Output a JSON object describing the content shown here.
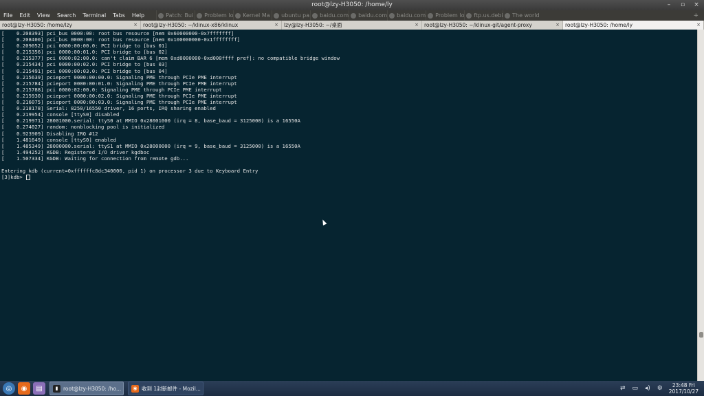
{
  "window": {
    "title": "root@lzy-H3050: /home/ly",
    "controls": [
      "–",
      "▫",
      "×"
    ]
  },
  "menubar": {
    "items": [
      "File",
      "Edit",
      "View",
      "Search",
      "Terminal",
      "Tabs",
      "Help"
    ],
    "background_tabs": [
      "Patch: Bui",
      "Problem lo",
      "Kernel Ma",
      "ubuntu pa",
      "baidu.com",
      "baidu.com",
      "baidu.com",
      "Problem lo",
      "ftp.us.debia",
      "The world"
    ],
    "right_add": "+"
  },
  "tabs": [
    {
      "label": "root@lzy-H3050: /home/lzy",
      "active": false
    },
    {
      "label": "root@lzy-H3050: ~/klinux-x86/klinux",
      "active": false
    },
    {
      "label": "lzy@lzy-H3050: ~/桌面",
      "active": false
    },
    {
      "label": "root@lzy-H3050: ~/klinux-git/agent-proxy",
      "active": false
    },
    {
      "label": "root@lzy-H3050: /home/ly",
      "active": true
    }
  ],
  "tab_close_glyph": "×",
  "terminal": {
    "lines": [
      "[    0.208393] pci_bus 0000:00: root bus resource [mem 0x60000000-0x7fffffff]",
      "[    0.208400] pci_bus 0000:00: root bus resource [mem 0x100000000-0x1ffffffff]",
      "[    0.209052] pci 0000:00:00.0: PCI bridge to [bus 01]",
      "[    0.215356] pci 0000:00:01.0: PCI bridge to [bus 02]",
      "[    0.215377] pci 0000:02:00.0: can't claim BAR 6 [mem 0xd0000000-0xd000ffff pref]: no compatible bridge window",
      "[    0.215434] pci 0000:00:02.0: PCI bridge to [bus 03]",
      "[    0.215491] pci 0000:00:03.0: PCI bridge to [bus 04]",
      "[    0.215639] pcieport 0000:00:00.0: Signaling PME through PCIe PME interrupt",
      "[    0.215784] pcieport 0000:00:01.0: Signaling PME through PCIe PME interrupt",
      "[    0.215788] pci 0000:02:00.0: Signaling PME through PCIe PME interrupt",
      "[    0.215930] pcieport 0000:00:02.0: Signaling PME through PCIe PME interrupt",
      "[    0.216075] pcieport 0000:00:03.0: Signaling PME through PCIe PME interrupt",
      "[    0.218178] Serial: 8250/16550 driver, 16 ports, IRQ sharing enabled",
      "[    0.219954] console [ttyS0] disabled",
      "[    0.219971] 28001000.serial: ttyS0 at MMIO 0x28001000 (irq = 8, base_baud = 3125000) is a 16550A",
      "[    0.274027] random: nonblocking pool is initialized",
      "[    0.923909] Disabling IRQ #12",
      "[    1.481649] console [ttyS0] enabled",
      "[    1.485349] 28000000.serial: ttyS1 at MMIO 0x28000000 (irq = 9, base_baud = 3125000) is a 16550A",
      "[    1.494252] KGDB: Registered I/O driver kgdboc",
      "[    1.507334] KGDB: Waiting for connection from remote gdb...",
      "",
      "Entering kdb (current=0xffffffc8dc340000, pid 1) on processor 3 due to Keyboard Entry"
    ],
    "prompt": "[3]kdb> "
  },
  "taskbar": {
    "launchers": [
      {
        "name": "start",
        "glyph": "◎"
      },
      {
        "name": "firefox",
        "glyph": "◉"
      },
      {
        "name": "files",
        "glyph": "▤"
      }
    ],
    "tasks": [
      {
        "label": "root@lzy-H3050: /ho...",
        "glyph": "▮"
      },
      {
        "label": "收到 1封新邮件 - Mozil...",
        "glyph": "◉"
      }
    ],
    "tray_icons": [
      "⇄",
      "▭",
      "◂)",
      "⚙"
    ],
    "clock_time": "23:48 Fri",
    "clock_date": "2017/10/27"
  },
  "colors": {
    "terminal_bg": "#062430",
    "terminal_fg": "#e2e2e2",
    "taskbar_bg": "#1c2c42"
  }
}
